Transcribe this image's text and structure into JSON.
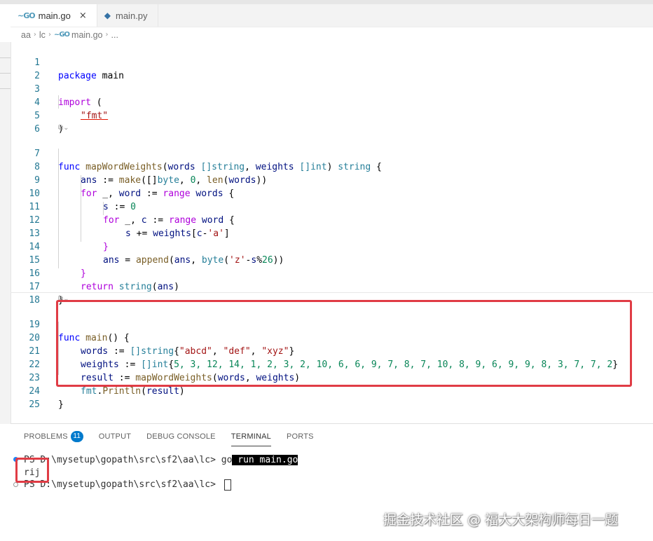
{
  "tabs": [
    {
      "icon": "go-file-icon",
      "label": "main.go",
      "active": true,
      "close": "×"
    },
    {
      "icon": "python-file-icon",
      "label": "main.py",
      "active": false
    }
  ],
  "breadcrumb": [
    "aa",
    "lc",
    "main.go",
    "..."
  ],
  "editor": {
    "code_lens": "⧉⌄",
    "lines": [
      {
        "n": "1"
      },
      {
        "n": "2"
      },
      {
        "n": "3"
      },
      {
        "n": "4"
      },
      {
        "n": "5"
      },
      {
        "n": "6"
      },
      {
        "n": "7"
      },
      {
        "n": "8"
      },
      {
        "n": "9"
      },
      {
        "n": "10"
      },
      {
        "n": "11"
      },
      {
        "n": "12"
      },
      {
        "n": "13"
      },
      {
        "n": "14"
      },
      {
        "n": "15"
      },
      {
        "n": "16"
      },
      {
        "n": "17"
      },
      {
        "n": "18"
      },
      {
        "n": "19"
      },
      {
        "n": "20"
      },
      {
        "n": "21"
      },
      {
        "n": "22"
      },
      {
        "n": "23"
      },
      {
        "n": "24"
      },
      {
        "n": "25"
      }
    ],
    "tokens": {
      "l1": [
        "package",
        " main"
      ],
      "l3": [
        "import",
        " ("
      ],
      "l4": [
        "\"fmt\""
      ],
      "l5": [
        ")"
      ],
      "l7": [
        "func",
        " ",
        "mapWordWeights",
        "(",
        "words",
        " ",
        "[]string",
        ", ",
        "weights",
        " ",
        "[]int",
        ") ",
        "string",
        " {"
      ],
      "l8": [
        "ans",
        " := ",
        "make",
        "([]",
        "byte",
        ", ",
        "0",
        ", ",
        "len",
        "(",
        "words",
        "))"
      ],
      "l9": [
        "for",
        " _, ",
        "word",
        " := ",
        "range",
        " ",
        "words",
        " {"
      ],
      "l10": [
        "s",
        " := ",
        "0"
      ],
      "l11": [
        "for",
        " _, ",
        "c",
        " := ",
        "range",
        " ",
        "word",
        " {"
      ],
      "l12": [
        "s",
        " += ",
        "weights",
        "[",
        "c",
        "-",
        "'a'",
        "]"
      ],
      "l13": [
        "}"
      ],
      "l14": [
        "ans",
        " = ",
        "append",
        "(",
        "ans",
        ", ",
        "byte",
        "(",
        "'z'",
        "-",
        "s",
        "%",
        "26",
        "))"
      ],
      "l15": [
        "}"
      ],
      "l16": [
        "return",
        " ",
        "string",
        "(",
        "ans",
        ")"
      ],
      "l17": [
        "}"
      ],
      "l19": [
        "func",
        " ",
        "main",
        "() {"
      ],
      "l20": [
        "words",
        " := ",
        "[]string",
        "{",
        "\"abcd\"",
        ", ",
        "\"def\"",
        ", ",
        "\"xyz\"",
        "}"
      ],
      "l21": [
        "weights",
        " := ",
        "[]int",
        "{",
        "5, 3, 12, 14, 1, 2, 3, 2, 10, 6, 6, 9, 7, 8, 7, 10, 8, 9, 6, 9, 9, 8, 3, 7, 7, 2",
        "}"
      ],
      "l22": [
        "result",
        " := ",
        "mapWordWeights",
        "(",
        "words",
        ", ",
        "weights",
        ")"
      ],
      "l23": [
        "fmt",
        ".",
        "Println",
        "(",
        "result",
        ")"
      ],
      "l24": [
        "}"
      ]
    }
  },
  "panel": {
    "tabs": [
      "PROBLEMS",
      "OUTPUT",
      "DEBUG CONSOLE",
      "TERMINAL",
      "PORTS"
    ],
    "problems_count": "11",
    "active_tab": "TERMINAL"
  },
  "terminal": {
    "prompt1": "PS D:\\mysetup\\gopath\\src\\sf2\\aa\\lc> ",
    "cmd_go": "go",
    "cmd_rest": " run main.go",
    "output": "rij",
    "prompt2": "PS D:\\mysetup\\gopath\\src\\sf2\\aa\\lc> "
  },
  "watermark": "掘金技术社区 @ 福大大架构师每日一题",
  "colors": {
    "highlight": "#e03c45",
    "keyword": "#0000ff",
    "string": "#a31515",
    "number": "#098658",
    "type": "#267f99",
    "function": "#795e26"
  }
}
